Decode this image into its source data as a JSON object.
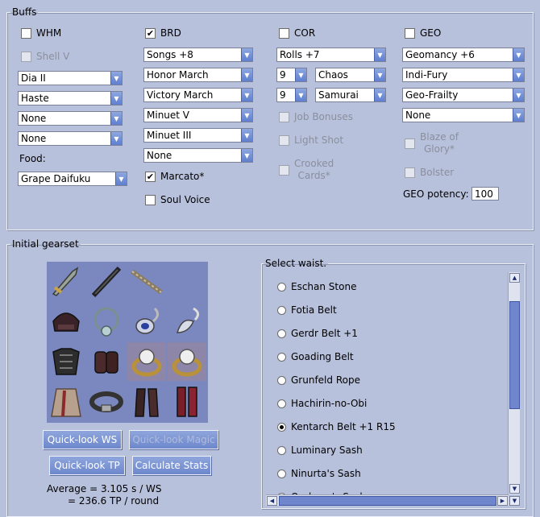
{
  "buffs": {
    "legend": "Buffs",
    "whm": {
      "label": "WHM",
      "shell": "Shell V",
      "selects": [
        "Dia II",
        "Haste",
        "None",
        "None"
      ],
      "food_label": "Food:",
      "food_value": "Grape Daifuku"
    },
    "brd": {
      "label": "BRD",
      "selects": [
        "Songs +8",
        "Honor March",
        "Victory March",
        "Minuet V",
        "Minuet III",
        "None"
      ],
      "marcato": "Marcato*",
      "soul_voice": "Soul Voice"
    },
    "cor": {
      "label": "COR",
      "rolls": "Rolls +7",
      "roll1_num": "9",
      "roll1_name": "Chaos",
      "roll2_num": "9",
      "roll2_name": "Samurai",
      "job_bonuses": "Job Bonuses",
      "light_shot": "Light Shot",
      "crooked_cards_1": "Crooked",
      "crooked_cards_2": "Cards*"
    },
    "geo": {
      "label": "GEO",
      "selects": [
        "Geomancy +6",
        "Indi-Fury",
        "Geo-Frailty",
        "None"
      ],
      "blaze_1": "Blaze of",
      "blaze_2": "Glory*",
      "bolster": "Bolster",
      "potency_label": "GEO potency:",
      "potency_value": "100"
    }
  },
  "gearset": {
    "legend": "Initial gearset",
    "buttons": {
      "quicklook_ws": "Quick-look WS",
      "quicklook_magic": "Quick-look Magic",
      "quicklook_tp": "Quick-look TP",
      "calculate_stats": "Calculate Stats"
    },
    "average_line1": "Average =  3.105 s / WS",
    "average_line2": "=  236.6 TP / round"
  },
  "waist": {
    "legend": "Select waist.",
    "options": [
      "Eschan Stone",
      "Fotia Belt",
      "Gerdr Belt +1",
      "Goading Belt",
      "Grunfeld Rope",
      "Hachirin-no-Obi",
      "Kentarch Belt +1 R15",
      "Luminary Sash",
      "Ninurta's Sash",
      "Orpheus's Sash"
    ],
    "selected": "Kentarch Belt +1 R15"
  },
  "icons": {
    "check": "✔",
    "arrow_down": "▼",
    "arrow_up": "▲",
    "arrow_left": "◀",
    "arrow_right": "▶"
  },
  "colors": {
    "background": "#b8c1dc",
    "button": "#7b91d0",
    "scrollbar": "#6f86cc"
  }
}
